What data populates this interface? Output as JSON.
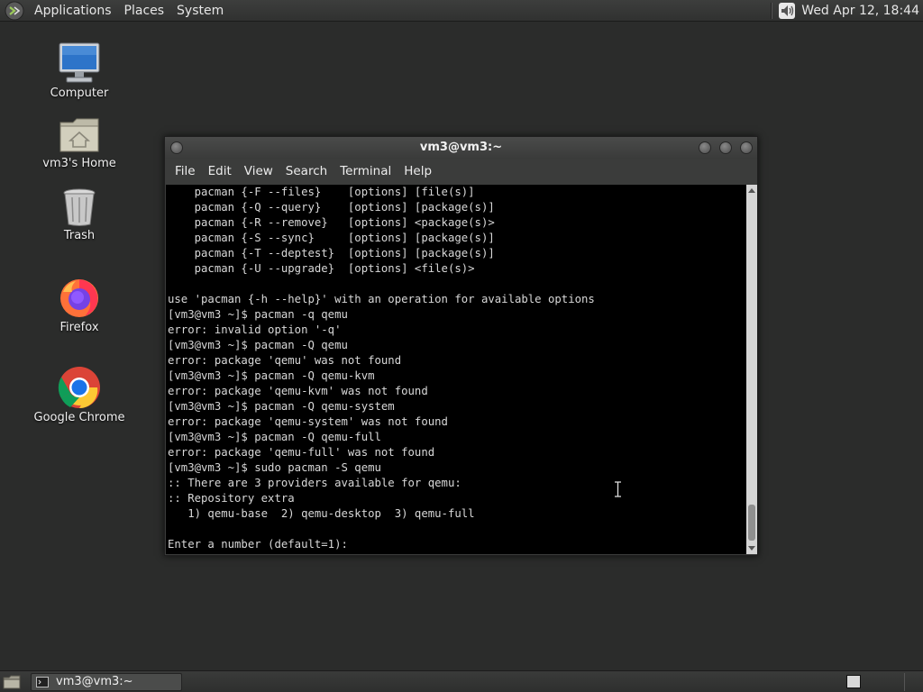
{
  "top_panel": {
    "menus": [
      "Applications",
      "Places",
      "System"
    ],
    "clock": "Wed Apr 12, 18:44"
  },
  "desktop": {
    "icons": [
      {
        "label": "Computer",
        "icon": "computer-icon"
      },
      {
        "label": "vm3's Home",
        "icon": "home-folder-icon"
      },
      {
        "label": "Trash",
        "icon": "trash-icon"
      },
      {
        "label": "Firefox",
        "icon": "firefox-icon"
      },
      {
        "label": "Google Chrome",
        "icon": "chrome-icon"
      }
    ]
  },
  "terminal": {
    "title": "vm3@vm3:~",
    "menu": [
      "File",
      "Edit",
      "View",
      "Search",
      "Terminal",
      "Help"
    ],
    "lines": [
      "    pacman {-F --files}    [options] [file(s)]",
      "    pacman {-Q --query}    [options] [package(s)]",
      "    pacman {-R --remove}   [options] <package(s)>",
      "    pacman {-S --sync}     [options] [package(s)]",
      "    pacman {-T --deptest}  [options] [package(s)]",
      "    pacman {-U --upgrade}  [options] <file(s)>",
      "",
      "use 'pacman {-h --help}' with an operation for available options",
      "[vm3@vm3 ~]$ pacman -q qemu",
      "error: invalid option '-q'",
      "[vm3@vm3 ~]$ pacman -Q qemu",
      "error: package 'qemu' was not found",
      "[vm3@vm3 ~]$ pacman -Q qemu-kvm",
      "error: package 'qemu-kvm' was not found",
      "[vm3@vm3 ~]$ pacman -Q qemu-system",
      "error: package 'qemu-system' was not found",
      "[vm3@vm3 ~]$ pacman -Q qemu-full",
      "error: package 'qemu-full' was not found",
      "[vm3@vm3 ~]$ sudo pacman -S qemu",
      ":: There are 3 providers available for qemu:",
      ":: Repository extra",
      "   1) qemu-base  2) qemu-desktop  3) qemu-full",
      "",
      "Enter a number (default=1):"
    ]
  },
  "taskbar": {
    "task_label": "vm3@vm3:~"
  },
  "colors": {
    "desktop_bg": "#2b2c2b",
    "terminal_bg": "#000000",
    "terminal_fg": "#d8d8d8"
  }
}
